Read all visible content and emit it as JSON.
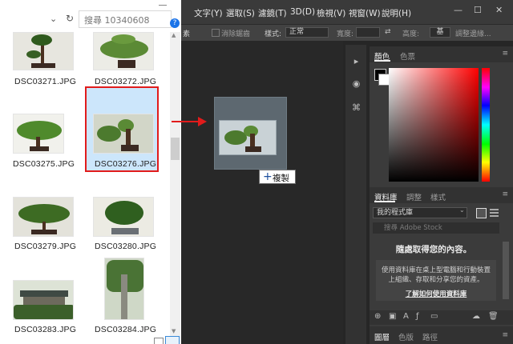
{
  "explorer": {
    "search_placeholder": "搜尋 10340608",
    "help_icon": "?",
    "files": [
      {
        "name": "DSC03271.JPG"
      },
      {
        "name": "DSC03272.JPG"
      },
      {
        "name": "DSC03275.JPG"
      },
      {
        "name": "DSC03276.JPG",
        "selected": true
      },
      {
        "name": "DSC03279.JPG"
      },
      {
        "name": "DSC03280.JPG"
      },
      {
        "name": "DSC03283.JPG"
      },
      {
        "name": "DSC03284.JPG"
      }
    ]
  },
  "photoshop": {
    "menu": [
      "文字(Y)",
      "選取(S)",
      "濾鏡(T)",
      "3D(D)",
      "檢視(V)",
      "視窗(W)",
      "說明(H)"
    ],
    "window_controls": {
      "minimize": "—",
      "maximize": "☐",
      "close": "✕"
    },
    "options_bar": {
      "partial_label": "素",
      "antialias_label": "消除鋸齒",
      "style_label": "樣式:",
      "style_value": "正常",
      "width_label": "寬度:",
      "height_label": "高度:",
      "height_value": "基",
      "refine_label": "調整邊緣..."
    },
    "drag_tooltip": {
      "plus": "+",
      "label": "複製"
    },
    "color_panel": {
      "tabs": [
        "顏色",
        "色票"
      ],
      "foreground": "#000000",
      "background": "#ffffff"
    },
    "library_panel": {
      "tabs": [
        "資料庫",
        "調整",
        "樣式"
      ],
      "library_select": "我的程式庫",
      "search_placeholder": "搜尋 Adobe Stock",
      "heading": "隨處取得您的內容。",
      "desc_line1": "使用資料庫在桌上型電腦和行動裝置",
      "desc_line2": "上組織、存取和分享您的資產。",
      "link": "了解如何使用資料庫"
    },
    "bottom_tabs": [
      "圖層",
      "色版",
      "路徑"
    ]
  },
  "colors": {
    "selection_border": "#e11b1b",
    "selection_fill": "#cce6fb",
    "arrow": "#e11b1b",
    "ps_bg": "#262626"
  }
}
